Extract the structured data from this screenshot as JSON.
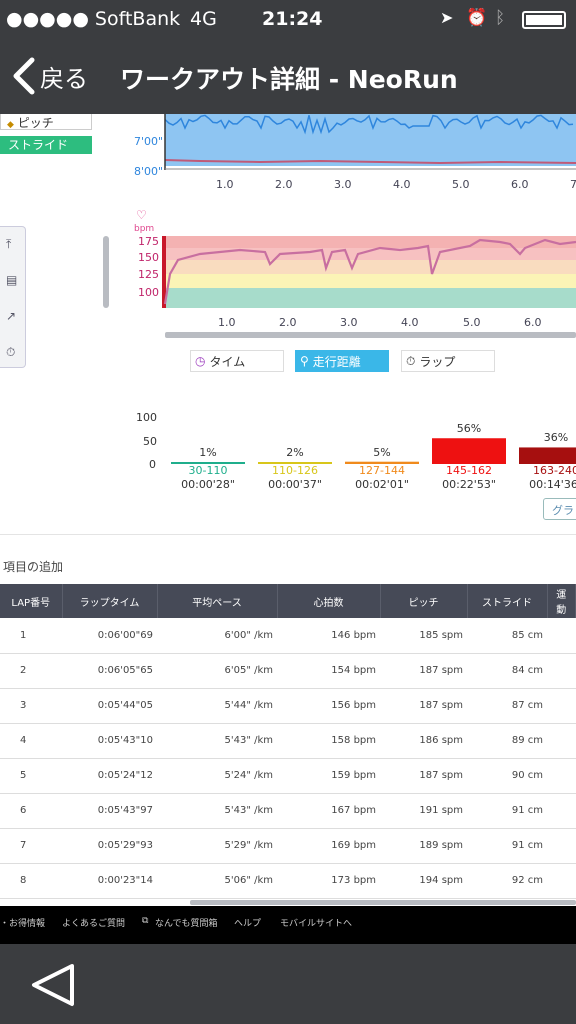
{
  "status": {
    "carrier": "●●●●● SoftBank",
    "network": "4G",
    "time": "21:24"
  },
  "nav": {
    "back_label": "戻る",
    "title": "ワークアウト詳細 - NeoRun"
  },
  "legend": {
    "pitch_label": "ピッチ",
    "stride_label": "ストライド"
  },
  "pace_chart": {
    "y_ticks": [
      "7'00\"",
      "8'00\""
    ],
    "x_ticks": [
      "1.0",
      "2.0",
      "3.0",
      "4.0",
      "5.0",
      "6.0",
      "7"
    ],
    "colors": {
      "fill": "#8ec5f2",
      "line": "#2f86dd",
      "hr_line": "#c05a78"
    }
  },
  "hr_chart": {
    "unit": "bpm",
    "y_ticks": [
      "175",
      "150",
      "125",
      "100"
    ],
    "x_ticks": [
      "1.0",
      "2.0",
      "3.0",
      "4.0",
      "5.0",
      "6.0"
    ],
    "colors": {
      "line": "#c86fa0",
      "zone1": "#a7dccb",
      "zone2": "#fbf4b6",
      "zone3": "#f9dcbf",
      "zone4": "#f7c1c1",
      "zone5": "#f4b2b2"
    }
  },
  "chart_data": {
    "type": "bar",
    "title": "",
    "categories": [
      "30-110",
      "110-126",
      "127-144",
      "145-162",
      "163-240"
    ],
    "values": [
      1,
      2,
      5,
      56,
      36
    ],
    "value_labels": [
      "1%",
      "2%",
      "5%",
      "56%",
      "36%"
    ],
    "durations": [
      "00:00'28\"",
      "00:00'37\"",
      "00:02'01\"",
      "00:22'53\"",
      "00:14'36\""
    ],
    "colors": [
      "#1fae8c",
      "#d8c61a",
      "#f08a1c",
      "#ee1111",
      "#a60f0f"
    ],
    "y_ticks": [
      "100",
      "50",
      "0"
    ],
    "ylim": [
      0,
      100
    ]
  },
  "tabs": {
    "time": "タイム",
    "distance": "走行距離",
    "lap": "ラップ"
  },
  "graph_button": "グラフ",
  "add_item": "項目の追加",
  "table": {
    "headers": [
      "LAP番号",
      "ラップタイム",
      "平均ペース",
      "心拍数",
      "ピッチ",
      "ストライド",
      "運動"
    ],
    "rows": [
      [
        "1",
        "0:06'00\"69",
        "6'00\" /km",
        "146 bpm",
        "185 spm",
        "85 cm"
      ],
      [
        "2",
        "0:06'05\"65",
        "6'05\" /km",
        "154 bpm",
        "187 spm",
        "84 cm"
      ],
      [
        "3",
        "0:05'44\"05",
        "5'44\" /km",
        "156 bpm",
        "187 spm",
        "87 cm"
      ],
      [
        "4",
        "0:05'43\"10",
        "5'43\" /km",
        "158 bpm",
        "186 spm",
        "89 cm"
      ],
      [
        "5",
        "0:05'24\"12",
        "5'24\" /km",
        "159 bpm",
        "187 spm",
        "90 cm"
      ],
      [
        "6",
        "0:05'43\"97",
        "5'43\" /km",
        "167 bpm",
        "191 spm",
        "91 cm"
      ],
      [
        "7",
        "0:05'29\"93",
        "5'29\" /km",
        "169 bpm",
        "189 spm",
        "91 cm"
      ],
      [
        "8",
        "0:00'23\"14",
        "5'06\" /km",
        "173 bpm",
        "194 spm",
        "92 cm"
      ]
    ]
  },
  "footer": {
    "links": [
      "・お得情報",
      "よくあるご質問",
      "なんでも質問箱",
      "ヘルプ",
      "モバイルサイトへ"
    ]
  }
}
